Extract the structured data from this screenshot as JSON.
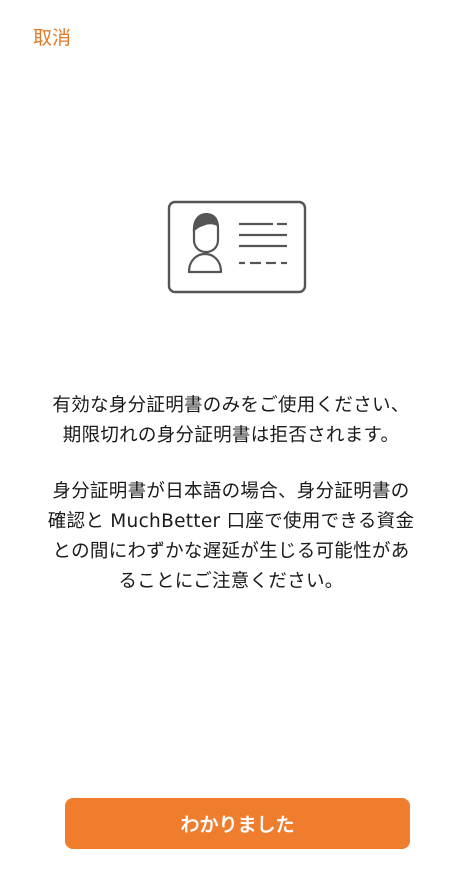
{
  "header": {
    "cancel_label": "取消"
  },
  "illustration": {
    "icon": "id-card-icon",
    "stroke_color": "#555555"
  },
  "message": {
    "paragraph1": [
      "有効な身分証明書のみをご使用ください、",
      "期限切れの身分証明書は拒否されます。"
    ],
    "paragraph2": [
      "身分証明書が日本語の場合、身分証明書の",
      "確認と MuchBetter 口座で使用できる資金",
      "との間にわずかな遅延が生じる可能性があ",
      "ることにご注意ください。"
    ]
  },
  "footer": {
    "confirm_label": "わかりました"
  },
  "colors": {
    "accent": "#e07b2c",
    "button_bg": "#f07c2d",
    "button_text": "#ffffff",
    "body_text": "#1a1a1a",
    "background": "#ffffff"
  }
}
